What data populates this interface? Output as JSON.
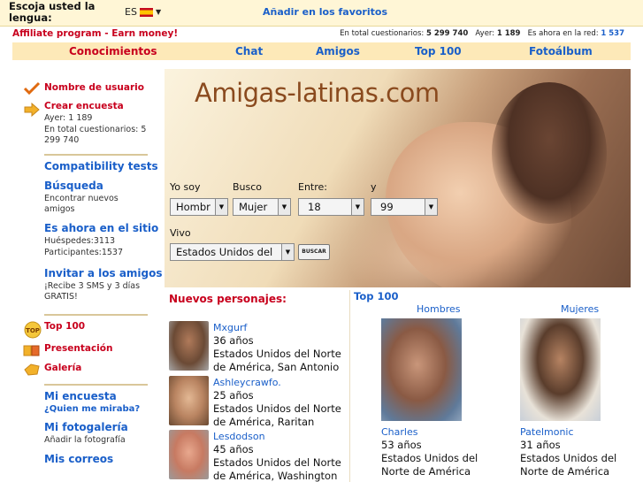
{
  "topbar": {
    "lang_label": "Escoja usted la lengua:",
    "lang_value": "ES",
    "favorites": "Añadir en los favoritos"
  },
  "affiliate": "Affiliate program - Earn money!",
  "stats": {
    "total_label": "En total cuestionarios:",
    "total_value": "5 299 740",
    "ayer_label": "Ayer:",
    "ayer_value": "1 189",
    "online_label": "Es ahora en la red:",
    "online_value": "1 537"
  },
  "nav": [
    "Conocimientos",
    "Chat",
    "Amigos",
    "Top 100",
    "Fotoálbum"
  ],
  "sidebar": {
    "username": "Nombre de usuario",
    "create_survey": "Crear encuesta",
    "ayer_line": "Ayer: 1 189",
    "total_line": "En total cuestionarios: 5 299 740",
    "compat": "Compatibility tests",
    "busqueda": "Búsqueda",
    "busqueda_sub": "Encontrar nuevos amigos",
    "online": "Es ahora en el sitio",
    "guests": "Huéspedes:3113",
    "participants": "Participantes:1537",
    "invite": "Invitar a los amigos",
    "invite_sub": "¡Recibe 3 SMS y 3 días GRATIS!",
    "top100": "Top 100",
    "presentacion": "Presentación",
    "galeria": "Galería",
    "my_survey": "Mi encuesta",
    "who_viewed": "¿Quien me miraba?",
    "my_gallery": "Mi fotogalería",
    "add_photo": "Añadir la fotografía",
    "my_mail": "Mis correos"
  },
  "banner": {
    "title": "Amigas-latinas.com",
    "yo_soy": "Yo soy",
    "busco": "Busco",
    "entre": "Entre:",
    "y": "y",
    "yo_soy_value": "Hombr",
    "busco_value": "Mujer",
    "age_from": "18",
    "age_to": "99",
    "vivo": "Vivo",
    "vivo_value": "Estados Unidos del",
    "buscar": "BUSCAR"
  },
  "new_people": {
    "title": "Nuevos personajes:",
    "people": [
      {
        "name": "Mxgurf",
        "age": "36 años",
        "location": "Estados Unidos del Norte de América, San Antonio"
      },
      {
        "name": "Ashleycrawfo.",
        "age": "25 años",
        "location": "Estados Unidos del Norte de América, Raritan"
      },
      {
        "name": "Lesdodson",
        "age": "45 años",
        "location": "Estados Unidos del Norte de América, Washington"
      }
    ]
  },
  "top100": {
    "title": "Top 100",
    "men_header": "Hombres",
    "women_header": "Mujeres",
    "man": {
      "name": "Charles",
      "age": "53 años",
      "location": "Estados Unidos del Norte de América"
    },
    "woman": {
      "name": "Patelmonic",
      "age": "31 años",
      "location": "Estados Unidos del Norte de América"
    }
  },
  "colors": {
    "accent_red": "#c8001d",
    "link_blue": "#1a5fc9",
    "nav_bg": "#fde9b8",
    "topbar_bg": "#fff6d6"
  }
}
